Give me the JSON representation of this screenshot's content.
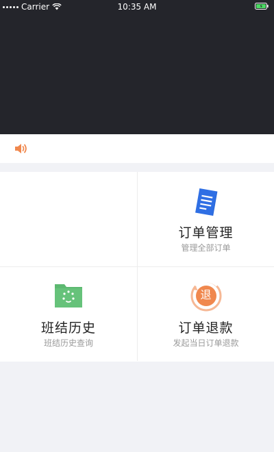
{
  "status_bar": {
    "carrier": "Carrier",
    "time": "10:35 AM",
    "battery_color": "#4cd964"
  },
  "notice": {
    "icon": "speaker-icon",
    "icon_color": "#f0884e"
  },
  "menu": [
    {
      "title": "",
      "subtitle": "",
      "icon": ""
    },
    {
      "title": "订单管理",
      "subtitle": "管理全部订单",
      "icon": "document-icon",
      "icon_color": "#2f6fe4"
    },
    {
      "title": "班结历史",
      "subtitle": "班结历史查询",
      "icon": "folder-history-icon",
      "icon_color": "#5cb870"
    },
    {
      "title": "订单退款",
      "subtitle": "发起当日订单退款",
      "icon": "refund-icon",
      "icon_label": "退",
      "icon_color": "#f0884e"
    }
  ],
  "colors": {
    "header_bg": "#24252b",
    "page_bg": "#f1f2f6",
    "card_bg": "#ffffff"
  }
}
